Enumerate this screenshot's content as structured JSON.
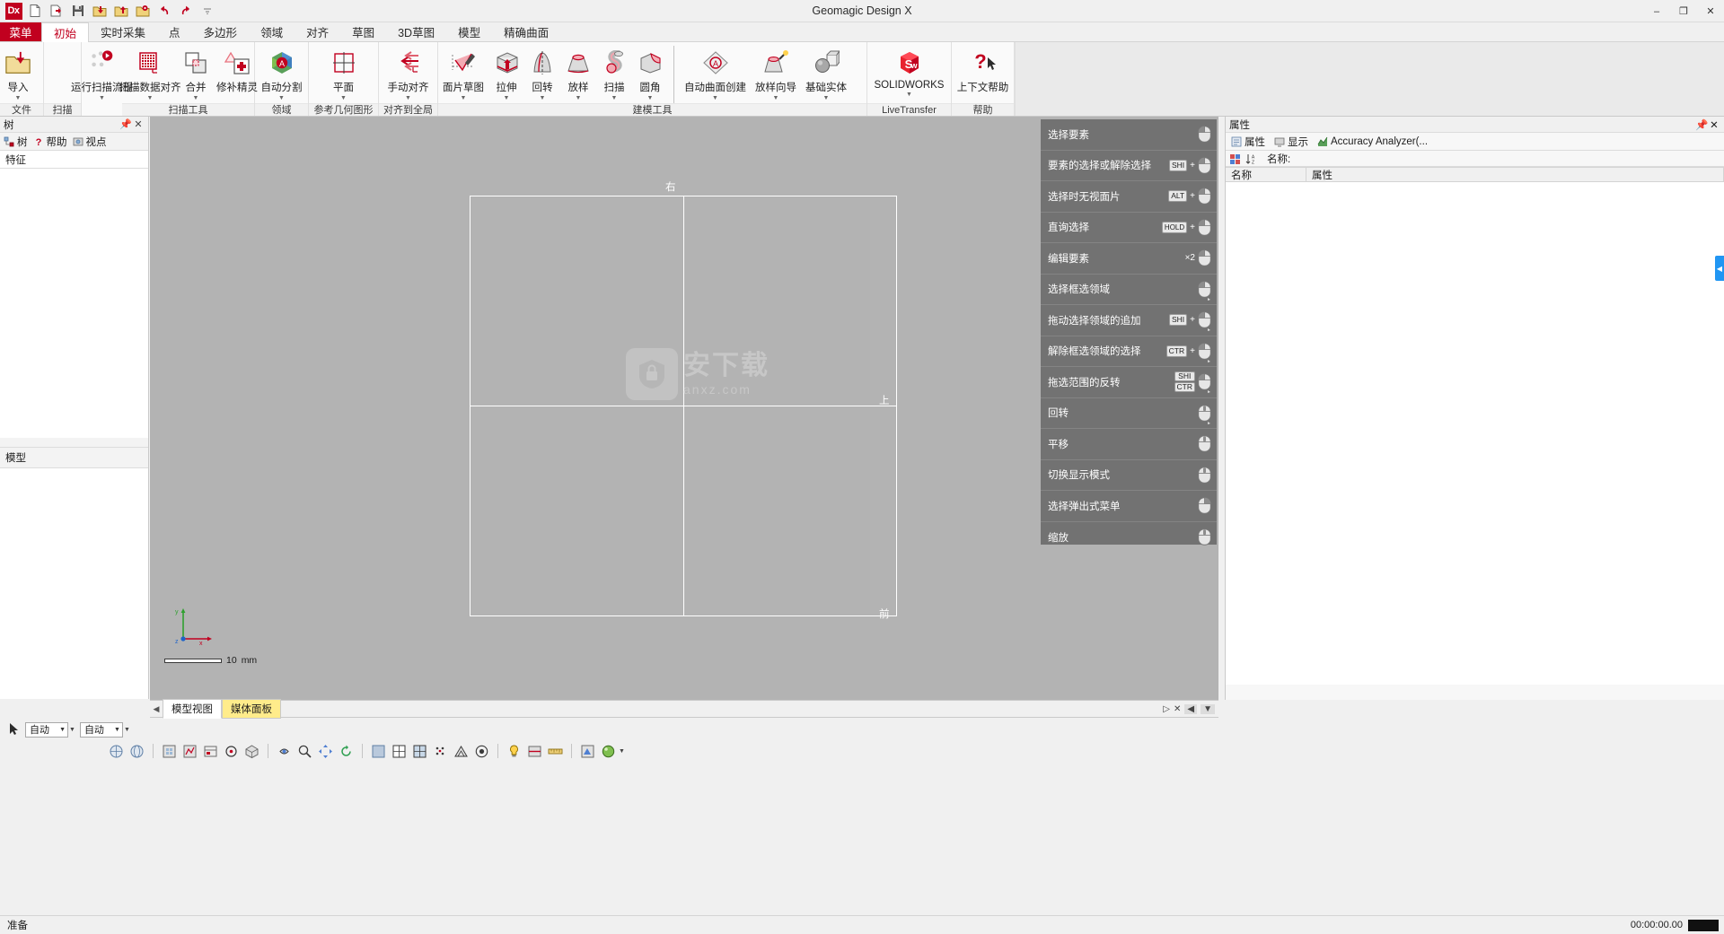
{
  "window": {
    "title": "Geomagic Design X",
    "app_logo": "Dx",
    "controls": {
      "minimize": "–",
      "maximize": "❐",
      "close": "✕"
    }
  },
  "quick_access": [
    {
      "name": "new-document-icon",
      "label": "新建"
    },
    {
      "name": "open-import-icon",
      "label": "打开"
    },
    {
      "name": "save-icon",
      "label": "保存"
    },
    {
      "name": "import-folder-icon",
      "label": "导入"
    },
    {
      "name": "export-folder-icon",
      "label": "导出"
    },
    {
      "name": "settings-folder-icon",
      "label": "选项"
    },
    {
      "name": "undo-icon",
      "label": "撤销"
    },
    {
      "name": "redo-icon",
      "label": "重做"
    },
    {
      "name": "qat-overflow-icon",
      "label": "更多"
    }
  ],
  "ribbon": {
    "menu_tab": "菜单",
    "tabs": [
      {
        "label": "初始",
        "active": true
      },
      {
        "label": "实时采集",
        "active": false
      },
      {
        "label": "点",
        "active": false
      },
      {
        "label": "多边形",
        "active": false
      },
      {
        "label": "领域",
        "active": false
      },
      {
        "label": "对齐",
        "active": false
      },
      {
        "label": "草图",
        "active": false
      },
      {
        "label": "3D草图",
        "active": false
      },
      {
        "label": "模型",
        "active": false
      },
      {
        "label": "精确曲面",
        "active": false
      }
    ],
    "groups": [
      {
        "label": "文件",
        "items": [
          {
            "label": "导入",
            "icon": "import-folder-icon",
            "dropdown": true
          }
        ]
      },
      {
        "label": "扫描",
        "items": [
          {
            "label": "运行扫描流程",
            "icon": "run-scan-process-icon",
            "dropdown": true
          }
        ]
      },
      {
        "label": "扫描工具",
        "items": [
          {
            "label": "扫描数据对齐",
            "icon": "align-scan-data-icon",
            "dropdown": true
          },
          {
            "label": "合并",
            "icon": "merge-icon",
            "dropdown": true
          },
          {
            "label": "修补精灵",
            "icon": "healing-wizard-icon",
            "dropdown": false
          }
        ]
      },
      {
        "label": "领域",
        "items": [
          {
            "label": "自动分割",
            "icon": "auto-segment-icon",
            "dropdown": true
          }
        ]
      },
      {
        "label": "参考几何图形",
        "items": [
          {
            "label": "平面",
            "icon": "plane-icon",
            "dropdown": true
          }
        ]
      },
      {
        "label": "对齐到全局",
        "items": [
          {
            "label": "手动对齐",
            "icon": "manual-align-icon",
            "dropdown": true
          }
        ]
      },
      {
        "label": "建模工具",
        "items": [
          {
            "label": "面片草图",
            "icon": "mesh-sketch-icon",
            "dropdown": true
          },
          {
            "label": "拉伸",
            "icon": "extrude-icon",
            "dropdown": true
          },
          {
            "label": "回转",
            "icon": "revolve-icon",
            "dropdown": true
          },
          {
            "label": "放样",
            "icon": "loft-icon",
            "dropdown": true
          },
          {
            "label": "扫描",
            "icon": "sweep-icon",
            "dropdown": true
          },
          {
            "label": "圆角",
            "icon": "fillet-icon",
            "dropdown": true
          },
          {
            "label": "自动曲面创建",
            "icon": "auto-surface-icon",
            "dropdown": true
          },
          {
            "label": "放样向导",
            "icon": "loft-wizard-icon",
            "dropdown": true
          },
          {
            "label": "基础实体",
            "icon": "primitive-solid-icon",
            "dropdown": true
          }
        ]
      },
      {
        "label": "LiveTransfer",
        "items": [
          {
            "label": "SOLIDWORKS",
            "icon": "solidworks-icon",
            "dropdown": true
          }
        ]
      },
      {
        "label": "帮助",
        "items": [
          {
            "label": "上下文帮助",
            "icon": "context-help-icon",
            "dropdown": false
          }
        ]
      }
    ]
  },
  "left_panel": {
    "title": "树",
    "pin_icon": "pin-icon",
    "close_icon": "close-icon",
    "tabs": [
      {
        "label": "树",
        "icon": "tree-icon"
      },
      {
        "label": "帮助",
        "icon": "help-icon"
      },
      {
        "label": "视点",
        "icon": "viewpoint-icon"
      }
    ],
    "section_feature": "特征",
    "section_model": "模型"
  },
  "viewport": {
    "labels": {
      "top": "右",
      "mid_right": "上",
      "bottom_right": "前"
    },
    "watermark": {
      "main": "安下载",
      "sub": "anxz.com"
    },
    "scale": {
      "value": "10",
      "unit": "mm"
    },
    "axes": {
      "x": "x",
      "y": "y",
      "z": "z"
    }
  },
  "mouse_hints": [
    {
      "label": "选择要素",
      "keys": [],
      "mouse": "left",
      "x2": false
    },
    {
      "label": "要素的选择或解除选择",
      "keys": [
        "SHI"
      ],
      "mouse": "left",
      "x2": false
    },
    {
      "label": "选择时无视面片",
      "keys": [
        "ALT"
      ],
      "mouse": "left",
      "x2": false
    },
    {
      "label": "直询选择",
      "keys": [
        "HOLD"
      ],
      "mouse": "left",
      "x2": false
    },
    {
      "label": "编辑要素",
      "keys": [],
      "mouse": "left",
      "x2": true
    },
    {
      "label": "选择框选领域",
      "keys": [],
      "mouse": "left-drag",
      "x2": false
    },
    {
      "label": "拖动选择领域的追加",
      "keys": [
        "SHI"
      ],
      "mouse": "left-drag",
      "x2": false
    },
    {
      "label": "解除框选领域的选择",
      "keys": [
        "CTR"
      ],
      "mouse": "left-drag",
      "x2": false
    },
    {
      "label": "拖选范围的反转",
      "keys": [
        "SHI",
        "CTR"
      ],
      "mouse": "left-drag",
      "x2": false
    },
    {
      "label": "回转",
      "keys": [],
      "mouse": "middle-drag",
      "x2": false
    },
    {
      "label": "平移",
      "keys": [],
      "mouse": "middle",
      "x2": false
    },
    {
      "label": "切换显示模式",
      "keys": [],
      "mouse": "middle-click",
      "x2": false
    },
    {
      "label": "选择弹出式菜单",
      "keys": [],
      "mouse": "right",
      "x2": false
    },
    {
      "label": "缩放",
      "keys": [],
      "mouse": "wheel",
      "x2": false
    }
  ],
  "right_panel": {
    "title": "属性",
    "pin_icon": "pin-icon",
    "close_icon": "close-icon",
    "tabs": [
      {
        "label": "属性",
        "icon": "properties-icon"
      },
      {
        "label": "显示",
        "icon": "display-icon"
      },
      {
        "label": "Accuracy Analyzer(...",
        "icon": "accuracy-analyzer-icon"
      }
    ],
    "toolbar": [
      {
        "name": "category-view-icon"
      },
      {
        "name": "sort-az-icon"
      }
    ],
    "name_label": "名称:",
    "grid_columns": [
      "名称",
      "属性"
    ]
  },
  "doc_tabs": {
    "prev_icon": "chevron-left-icon",
    "tabs": [
      {
        "label": "模型视图",
        "active": true,
        "highlight": false
      },
      {
        "label": "媒体面板",
        "active": false,
        "highlight": true
      }
    ],
    "right_controls": [
      {
        "name": "play-icon",
        "glyph": "▷"
      },
      {
        "name": "close-tab-icon",
        "glyph": "✕"
      },
      {
        "name": "prev-view-icon",
        "glyph": "◀"
      },
      {
        "name": "next-view-icon",
        "glyph": "▼"
      }
    ]
  },
  "bottom_toolbar_1": {
    "selection_icon": "selection-mode-icon",
    "combo1": {
      "value": "自动",
      "name": "selection-method-combo"
    },
    "combo2": {
      "value": "自动",
      "name": "selection-target-combo"
    }
  },
  "bottom_toolbar_2_icons": [
    "view-front-icon",
    "view-back-icon",
    "view-left-icon",
    "view-right-icon",
    "view-top-icon",
    "view-bottom-icon",
    "view-iso-icon",
    "fit-view-icon",
    "zoom-window-icon",
    "pan-icon",
    "rotate-icon",
    "shade-icon",
    "wireframe-icon",
    "shade-wire-icon",
    "points-icon",
    "mesh-icon",
    "texture-icon",
    "lighting-icon",
    "section-icon",
    "measure-icon",
    "color-icon",
    "render-icon"
  ],
  "status_bar": {
    "message": "准备",
    "timer": "00:00:00.00"
  },
  "colors": {
    "brand_red": "#c1001f",
    "viewport_bg": "#b3b3b3",
    "ribbon_bg": "#fafafa",
    "panel_bg": "#f3f3f3",
    "accent_blue": "#2196f3",
    "highlight_yellow": "#ffec8b"
  }
}
